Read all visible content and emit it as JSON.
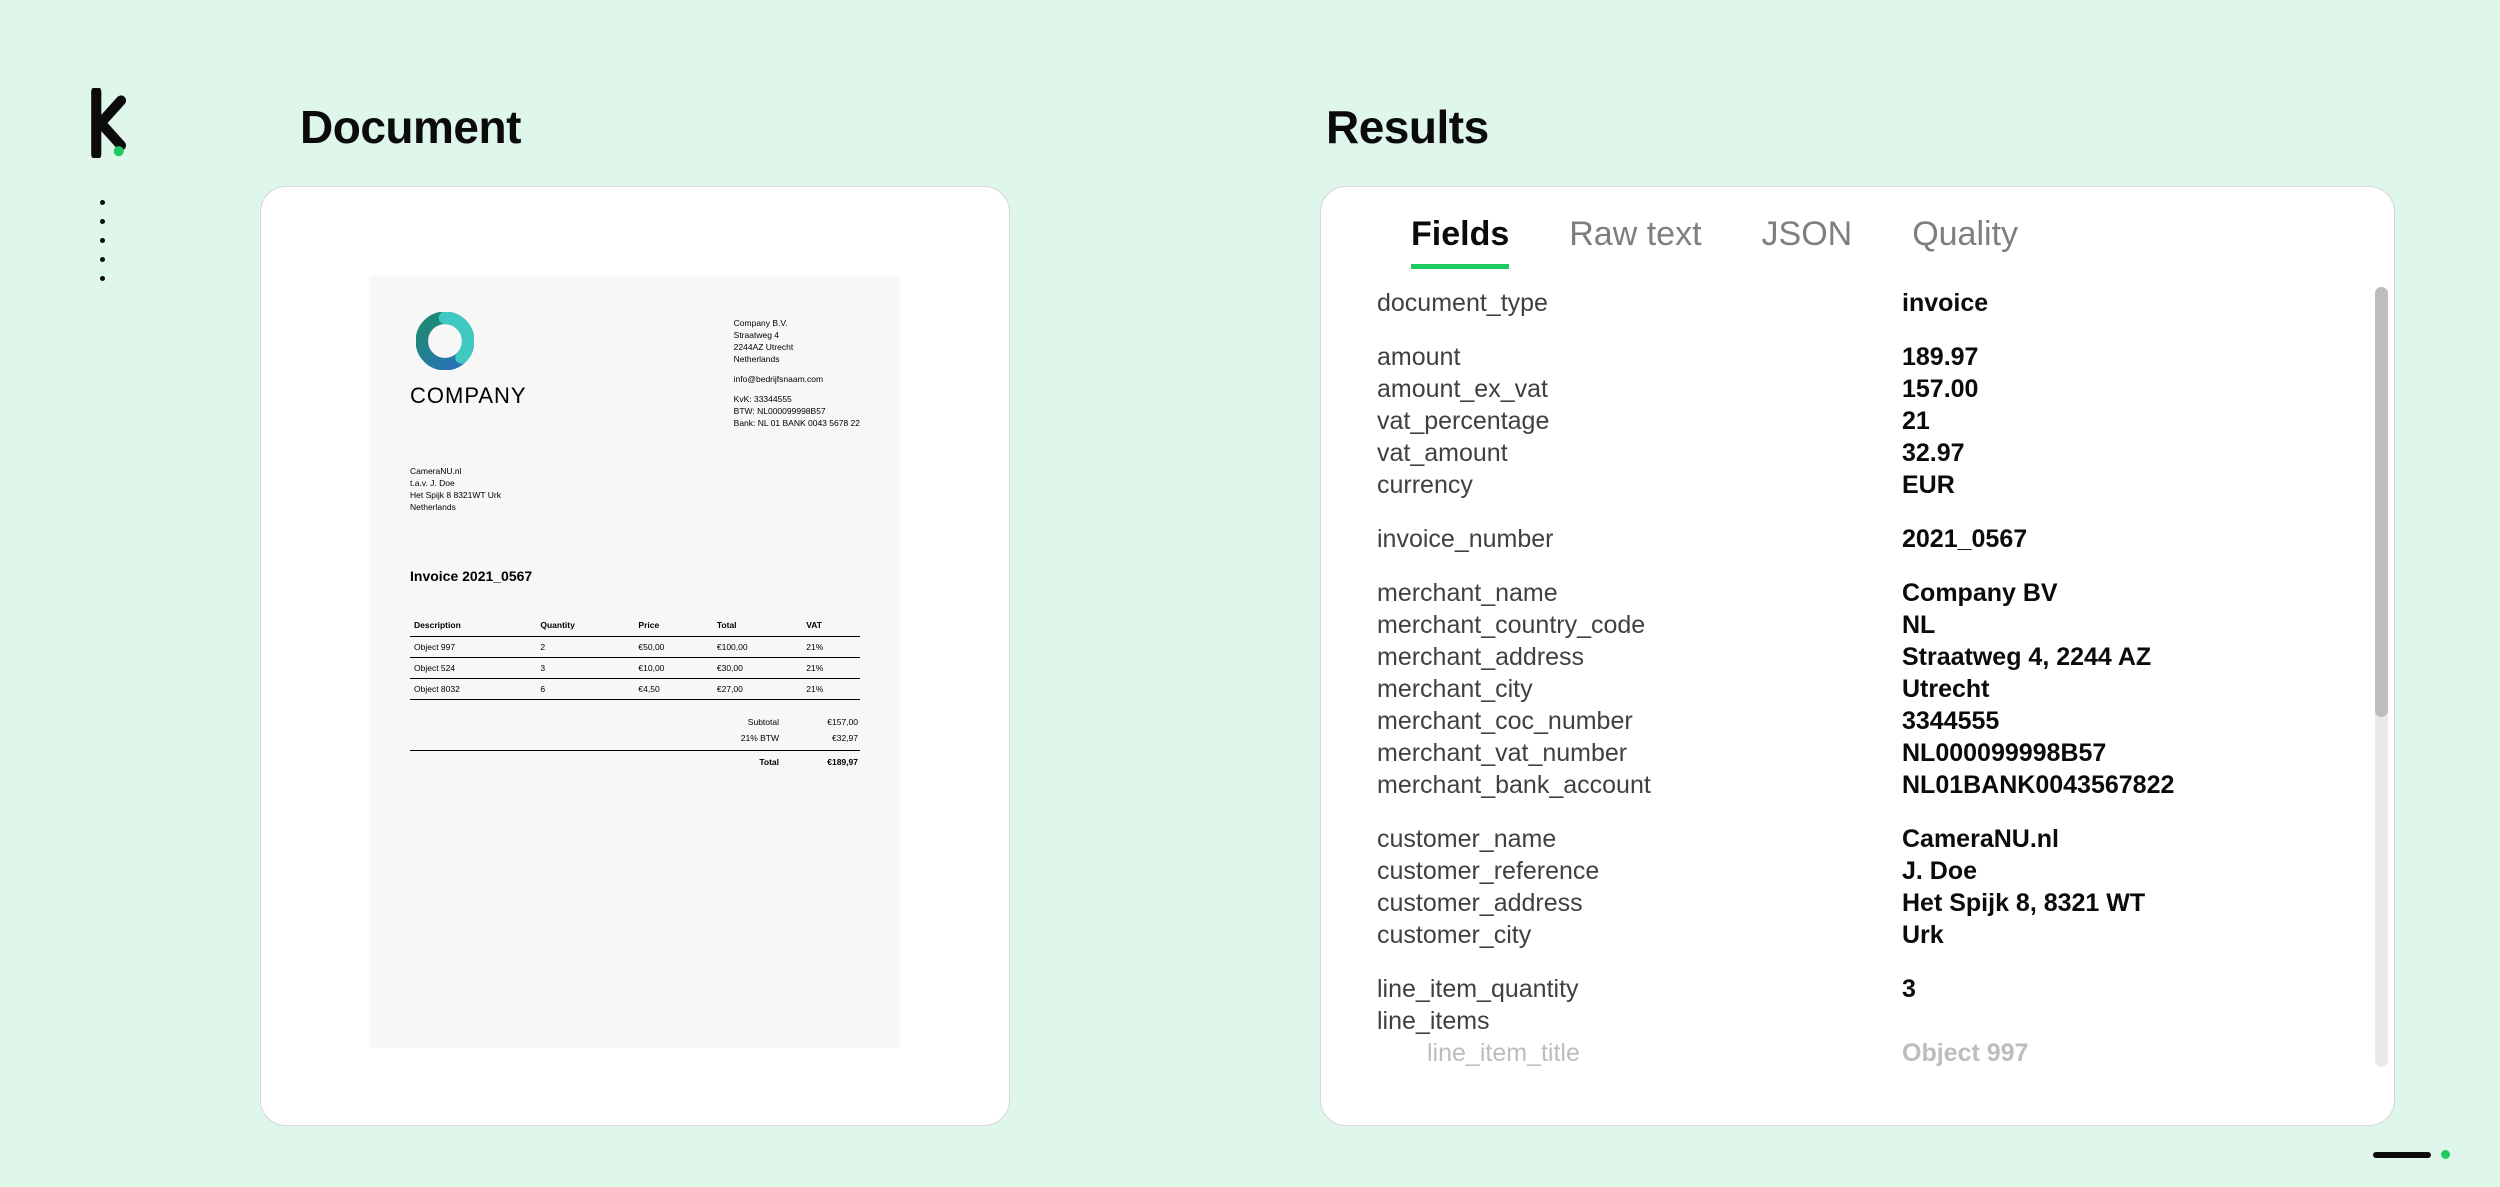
{
  "titles": {
    "document": "Document",
    "results": "Results"
  },
  "tabs": {
    "fields": "Fields",
    "raw": "Raw text",
    "json": "JSON",
    "quality": "Quality"
  },
  "invoice": {
    "company_name": "COMPANY",
    "company_block": {
      "name": "Company B.V.",
      "street": "Straatweg 4",
      "postcity": "2244AZ Utrecht",
      "country": "Netherlands",
      "email": "info@bedrijfsnaam.com",
      "kvk": "KvK: 33344555",
      "btw": "BTW: NL000099998B57",
      "bank": "Bank: NL 01 BANK 0043 5678 22"
    },
    "customer": {
      "name": "CameraNU.nl",
      "ref": "t.a.v. J. Doe",
      "street": "Het Spijk 8 8321WT Urk",
      "country": "Netherlands"
    },
    "title": "Invoice 2021_0567",
    "headers": {
      "desc": "Description",
      "qty": "Quantity",
      "price": "Price",
      "total": "Total",
      "vat": "VAT"
    },
    "lines": [
      {
        "desc": "Object 997",
        "qty": "2",
        "price": "€50,00",
        "total": "€100,00",
        "vat": "21%"
      },
      {
        "desc": "Object 524",
        "qty": "3",
        "price": "€10,00",
        "total": "€30,00",
        "vat": "21%"
      },
      {
        "desc": "Object 8032",
        "qty": "6",
        "price": "€4,50",
        "total": "€27,00",
        "vat": "21%"
      }
    ],
    "totals": {
      "subtotal_label": "Subtotal",
      "subtotal": "€157,00",
      "btw_label": "21% BTW",
      "btw": "€32,97",
      "total_label": "Total",
      "total": "€189,97"
    }
  },
  "fields": [
    [
      {
        "k": "document_type",
        "v": "invoice"
      }
    ],
    [
      {
        "k": "amount",
        "v": "189.97"
      },
      {
        "k": "amount_ex_vat",
        "v": "157.00"
      },
      {
        "k": "vat_percentage",
        "v": "21"
      },
      {
        "k": "vat_amount",
        "v": "32.97"
      },
      {
        "k": "currency",
        "v": "EUR"
      }
    ],
    [
      {
        "k": "invoice_number",
        "v": "2021_0567"
      }
    ],
    [
      {
        "k": "merchant_name",
        "v": "Company BV"
      },
      {
        "k": "merchant_country_code",
        "v": "NL"
      },
      {
        "k": "merchant_address",
        "v": "Straatweg 4, 2244 AZ"
      },
      {
        "k": "merchant_city",
        "v": "Utrecht"
      },
      {
        "k": "merchant_coc_number",
        "v": "3344555"
      },
      {
        "k": "merchant_vat_number",
        "v": "NL000099998B57"
      },
      {
        "k": "merchant_bank_account",
        "v": "NL01BANK0043567822"
      }
    ],
    [
      {
        "k": "customer_name",
        "v": "CameraNU.nl"
      },
      {
        "k": "customer_reference",
        "v": "J. Doe"
      },
      {
        "k": "customer_address",
        "v": "Het Spijk 8, 8321 WT"
      },
      {
        "k": "customer_city",
        "v": "Urk"
      }
    ],
    [
      {
        "k": "line_item_quantity",
        "v": "3"
      },
      {
        "k": "line_items",
        "v": ""
      },
      {
        "k": "line_item_title",
        "v": "Object 997",
        "indent": true,
        "faded": true
      }
    ]
  ]
}
